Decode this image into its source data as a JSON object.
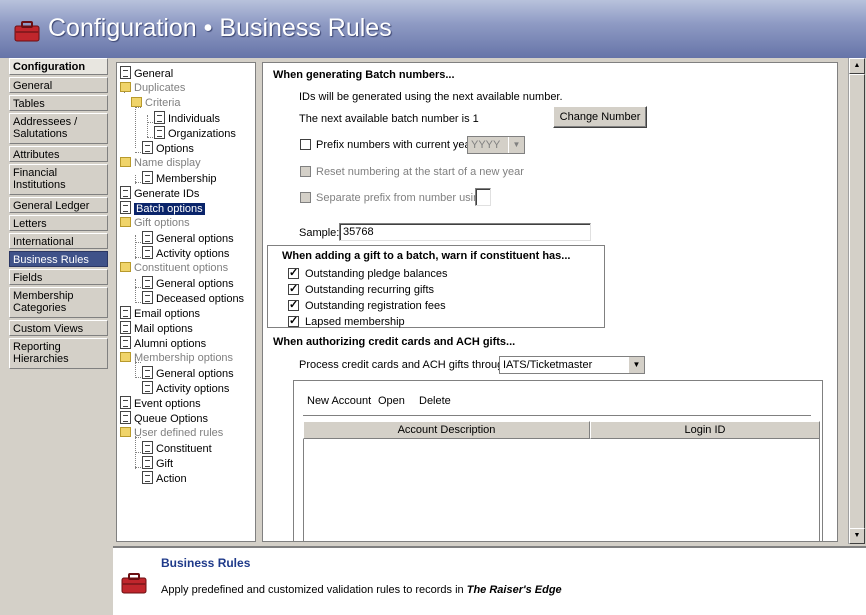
{
  "title": {
    "prefix": "Configuration",
    "separator": "•",
    "page": "Business Rules"
  },
  "nav": {
    "items": [
      {
        "label": "Configuration",
        "header": true
      },
      {
        "label": "General"
      },
      {
        "label": "Tables"
      },
      {
        "label": "Addressees / Salutations"
      },
      {
        "label": "Attributes"
      },
      {
        "label": "Financial Institutions"
      },
      {
        "label": "General Ledger"
      },
      {
        "label": "Letters"
      },
      {
        "label": "International"
      },
      {
        "label": "Business Rules",
        "selected": true
      },
      {
        "label": "Fields"
      },
      {
        "label": "Membership Categories"
      },
      {
        "label": "Custom Views"
      },
      {
        "label": "Reporting Hierarchies"
      }
    ]
  },
  "tree": {
    "items": [
      {
        "label": "General",
        "type": "doc",
        "level": 0
      },
      {
        "label": "Duplicates",
        "type": "folder",
        "level": 0
      },
      {
        "label": "Criteria",
        "type": "folder",
        "level": 1
      },
      {
        "label": "Individuals",
        "type": "doc",
        "level": 2
      },
      {
        "label": "Organizations",
        "type": "doc",
        "level": 2
      },
      {
        "label": "Options",
        "type": "doc",
        "level": 1
      },
      {
        "label": "Name display",
        "type": "folder",
        "level": 0
      },
      {
        "label": "Membership",
        "type": "doc",
        "level": 1
      },
      {
        "label": "Generate IDs",
        "type": "doc",
        "level": 0
      },
      {
        "label": "Batch options",
        "type": "doc",
        "level": 0,
        "selected": true
      },
      {
        "label": "Gift options",
        "type": "folder",
        "level": 0
      },
      {
        "label": "General options",
        "type": "doc",
        "level": 1
      },
      {
        "label": "Activity options",
        "type": "doc",
        "level": 1
      },
      {
        "label": "Constituent options",
        "type": "folder",
        "level": 0
      },
      {
        "label": "General options",
        "type": "doc",
        "level": 1
      },
      {
        "label": "Deceased options",
        "type": "doc",
        "level": 1
      },
      {
        "label": "Email options",
        "type": "doc",
        "level": 0
      },
      {
        "label": "Mail options",
        "type": "doc",
        "level": 0
      },
      {
        "label": "Alumni options",
        "type": "doc",
        "level": 0
      },
      {
        "label": "Membership options",
        "type": "folder",
        "level": 0
      },
      {
        "label": "General options",
        "type": "doc",
        "level": 1
      },
      {
        "label": "Activity options",
        "type": "doc",
        "level": 1
      },
      {
        "label": "Event options",
        "type": "doc",
        "level": 0
      },
      {
        "label": "Queue Options",
        "type": "doc",
        "level": 0
      },
      {
        "label": "User defined rules",
        "type": "folder",
        "level": 0
      },
      {
        "label": "Constituent",
        "type": "doc",
        "level": 1
      },
      {
        "label": "Gift",
        "type": "doc",
        "level": 1
      },
      {
        "label": "Action",
        "type": "doc",
        "level": 1
      }
    ]
  },
  "batch": {
    "heading": "When generating Batch numbers...",
    "info1": "IDs will be generated using the next available number.",
    "info2": "The next available batch number is 1",
    "change_number": "Change Number",
    "prefix_label": "Prefix numbers with current year",
    "prefix_checked": false,
    "year_format": "YYYY",
    "reset_label": "Reset numbering at the start of a new year",
    "separate_label": "Separate prefix from number using",
    "separator_value": "",
    "sample_label": "Sample:",
    "sample_value": "35768"
  },
  "warn": {
    "heading": "When adding a gift to a batch, warn if constituent has...",
    "items": [
      {
        "label": "Outstanding pledge balances",
        "checked": true
      },
      {
        "label": "Outstanding recurring gifts",
        "checked": true
      },
      {
        "label": "Outstanding registration fees",
        "checked": true
      },
      {
        "label": "Lapsed membership",
        "checked": true
      }
    ]
  },
  "cards": {
    "heading": "When authorizing credit cards and ACH gifts...",
    "process_label": "Process credit cards and ACH gifts through",
    "process_value": "IATS/Ticketmaster",
    "menu": {
      "new": "New Account",
      "open": "Open",
      "delete": "Delete"
    },
    "columns": [
      "Account Description",
      "Login ID"
    ]
  },
  "description": {
    "title": "Business Rules",
    "text": "Apply predefined and customized validation rules to records in",
    "product": "The Raiser's Edge"
  },
  "colors": {
    "title_bar": "#6674a8",
    "nav_selected": "#3f5289",
    "desc_title": "#1f3a8a"
  }
}
